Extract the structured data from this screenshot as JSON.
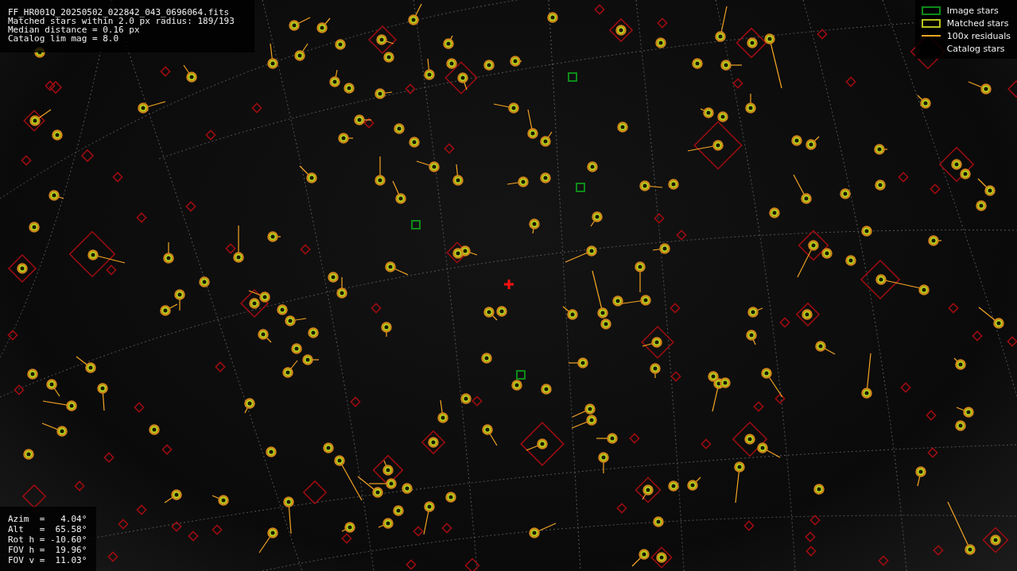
{
  "header_info": [
    "FF_HR001Q_20250502_022842_043_0696064.fits",
    "Matched stars within 2.0 px radius: 189/193",
    "Median distance = 0.16 px",
    "Catalog lim mag = 8.0"
  ],
  "legend": [
    {
      "kind": "image",
      "label": "Image stars"
    },
    {
      "kind": "matched",
      "label": "Matched stars"
    },
    {
      "kind": "residual",
      "label": "100x residuals"
    },
    {
      "kind": "catalog",
      "label": "Catalog stars"
    }
  ],
  "pointing_info": [
    "Azim  =   4.04°",
    "Alt   =  65.58°",
    "Rot h = -10.60°",
    "FOV h =  19.96°",
    "FOV v =  11.03°"
  ]
}
